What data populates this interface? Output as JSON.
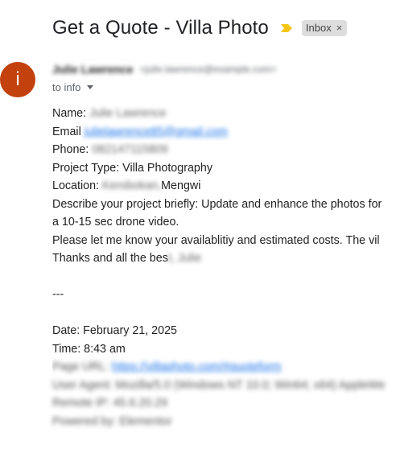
{
  "email": {
    "subject": "Get a Quote - Villa Photo",
    "label": "Inbox",
    "label_remove": "×",
    "avatar_letter": "i",
    "sender_name": "Julie Lawrence",
    "sender_email": "<julie.lawrence@example.com>",
    "to_text": "to info",
    "body": {
      "name_label": "Name:",
      "name_value": "Julie Lawrence",
      "email_label": "Email",
      "email_value": "julielawrence85@gmail.com",
      "phone_label": "Phone:",
      "phone_value": "082147115809",
      "project_type_label": "Project Type:",
      "project_type_value": "Villa Photography",
      "location_label": "Location:",
      "location_value_hidden": "Kerobokan,",
      "location_value_visible": "Mengwi",
      "describe_line1": "Describe your project briefly: Update and enhance the photos for",
      "describe_line2": "a 10-15 sec drone video.",
      "availability_line": "Please let me know your availablitiy and estimated costs. The vil",
      "thanks_visible": "Thanks and all the bes",
      "thanks_hidden": "t, Julie",
      "separator": "---",
      "date_line": "Date: February 21, 2025",
      "time_line": "Time: 8:43 am",
      "page_url_label": "Page URL:",
      "page_url_value": "https://villaphoto.com/#quoteform",
      "user_agent_line": "User Agent: Mozilla/5.0 (Windows NT 10.0; Win64; x64) AppleWe",
      "remote_ip_line": "Remote IP: 45.6.20.29",
      "powered_by_line": "Powered by: Elementor"
    }
  },
  "colors": {
    "avatar": "#c2410c",
    "importance_marker": "#f5c518",
    "link": "#1a73e8"
  }
}
